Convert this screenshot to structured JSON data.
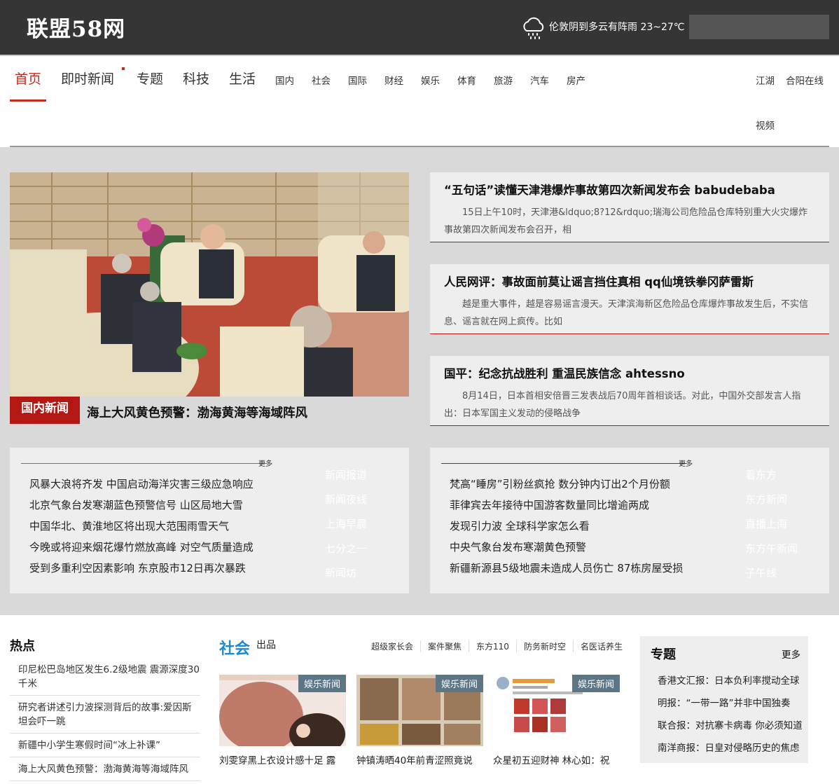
{
  "header": {
    "logo": "联盟58网",
    "weather": "伦敦阴到多云有阵雨 23~27℃"
  },
  "nav": {
    "main": [
      "首页",
      "即时新闻",
      "专题",
      "科技",
      "生活"
    ],
    "sub": [
      "国内",
      "社会",
      "国际",
      "财经",
      "娱乐",
      "体育",
      "旅游",
      "汽车",
      "房产"
    ],
    "right": [
      "江湖",
      "合阳在线",
      "视频"
    ]
  },
  "hero": {
    "tag": "国内新闻",
    "title": "海上大风黄色预警：渤海黄海等海域阵风"
  },
  "cards": [
    {
      "title": "“五句话”读懂天津港爆炸事故第四次新闻发布会 babudebaba",
      "summary": "15日上午10时，天津港&ldquo;8?12&rdquo;瑞海公司危险品仓库特别重大火灾爆炸事故第四次新闻发布会召开，相"
    },
    {
      "title": "人民网评：事故面前莫让谣言挡住真相 qq仙境铁拳冈萨雷斯",
      "summary": "越是重大事件，越是容易谣言漫天。天津滨海新区危险品仓库爆炸事故发生后，不实信息、谣言就在网上疯传。比如"
    },
    {
      "title": "国平：纪念抗战胜利 重温民族信念 ahtessno",
      "summary": "8月14日，日本首相安倍晋三发表战后70周年首相谈话。对此，中国外交部发言人指出：日本军国主义发动的侵略战争"
    }
  ],
  "box_left": {
    "more": "更多",
    "items": [
      "风暴大浪将齐发 中国启动海洋灾害三级应急响应",
      "北京气象台发寒潮蓝色预警信号 山区局地大雪",
      "中国华北、黄淮地区将出现大范围雨雪天气",
      "今晚或将迎来烟花爆竹燃放高峰 对空气质量造成",
      "受到多重利空因素影响 东京股市12日再次暴跌"
    ],
    "side": [
      "新闻报道",
      "新闻夜线",
      "上海早晨",
      "七分之一",
      "新闻坊"
    ],
    "line_color": "#1d8bd1"
  },
  "box_right": {
    "more": "更多",
    "items": [
      "梵高“睡房”引粉丝疯抢 数分钟内订出2个月份额",
      "菲律宾去年接待中国游客数量同比增逾两成",
      "发现引力波 全球科学家怎么看",
      "中央气象台发布寒潮黄色预警",
      "新疆新源县5级地震未造成人员伤亡 87栋房屋受损"
    ],
    "side": [
      "看东方",
      "东方新闻",
      "直播上海",
      "东方午新闻",
      "子午线"
    ],
    "line_color": "#b51813"
  },
  "hot": {
    "title": "热点",
    "items": [
      "印尼松巴岛地区发生6.2级地震 震源深度30千米",
      "研究者讲述引力波探测背后的故事:爱因斯坦会吓一跳",
      "新疆中小学生寒假时间“冰上补课”",
      "海上大风黄色预警：渤海黄海等海域阵风"
    ]
  },
  "society": {
    "title": "社会",
    "sub": "出品",
    "tags": [
      "超级家长会",
      "案件聚焦",
      "东方110",
      "防务新时空",
      "名医话养生"
    ],
    "pics": [
      {
        "tag": "娱乐新闻",
        "title": "刘雯穿黑上衣设计感十足 露"
      },
      {
        "tag": "娱乐新闻",
        "title": "钟镇涛晒40年前青涩照竟说"
      },
      {
        "tag": "娱乐新闻",
        "title": "众星初五迎财神 林心如：祝"
      }
    ]
  },
  "topics": {
    "title": "专题",
    "more": "更多",
    "items": [
      "香港文汇报：日本负利率搅动全球",
      "明报：“一带一路”并非中国独奏",
      "联合报：对抗寨卡病毒 你必须知道",
      "南洋商报：日皇对侵略历史的焦虑"
    ]
  }
}
